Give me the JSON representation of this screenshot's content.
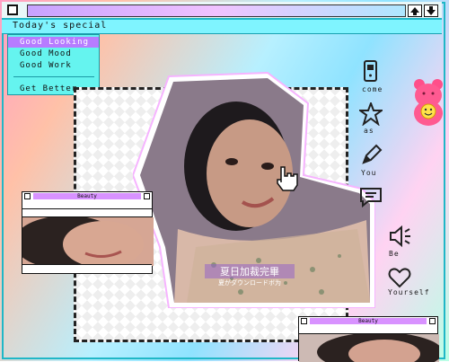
{
  "window": {
    "title": ""
  },
  "menubar": {
    "title": "Today's special"
  },
  "menu": {
    "items": [
      "Good Looking",
      "Good Mood",
      "Good Work"
    ],
    "footer": "Get Better",
    "active_index": 0
  },
  "side_nav": [
    {
      "label": "come",
      "icon": "phone-icon"
    },
    {
      "label": "as",
      "icon": "sparkle-icon"
    },
    {
      "label": "You",
      "icon": "pencil-icon"
    },
    {
      "label": "",
      "icon": "chat-icon"
    },
    {
      "label": "Be",
      "icon": "speaker-icon"
    },
    {
      "label": "Yourself",
      "icon": "heart-icon"
    }
  ],
  "caption": {
    "line1": "夏日加裁完畢",
    "line2": "夏がダウンロードボ为"
  },
  "mini_windows": [
    {
      "title": "Beauty"
    },
    {
      "title": "Beauty"
    }
  ],
  "colors": {
    "accent": "#20b7c7",
    "menu_bg": "#65f4ef",
    "highlight": "#b77cff",
    "title_purple": "#d892ff"
  }
}
